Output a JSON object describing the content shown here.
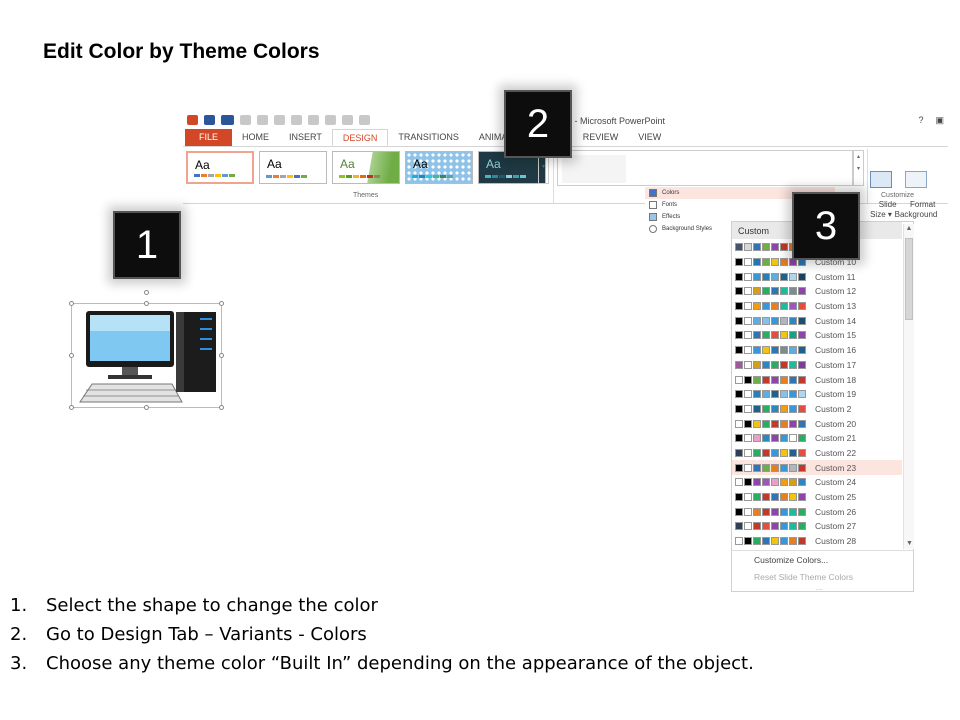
{
  "slide": {
    "title": "Edit Color by Theme Colors"
  },
  "ribbon": {
    "window_title": "e - Microsoft PowerPoint",
    "window_controls": [
      "?",
      "▣"
    ],
    "tabs": [
      {
        "label": "FILE"
      },
      {
        "label": "HOME"
      },
      {
        "label": "INSERT"
      },
      {
        "label": "DESIGN"
      },
      {
        "label": "TRANSITIONS"
      },
      {
        "label": "ANIMATIONS"
      },
      {
        "label": "W"
      },
      {
        "label": "REVIEW"
      },
      {
        "label": "VIEW"
      }
    ],
    "active_tab": "DESIGN",
    "themes_group_label": "Themes",
    "theme_thumb_text": "Aa",
    "slide_size_label": "Slide\nSize ▾",
    "format_background_label": "Format\nBackground",
    "customize_group_label": "Customize",
    "accent_color": "#d24726"
  },
  "variants_menu": {
    "items": [
      {
        "label": "Colors",
        "icon": "colors-icon",
        "highlighted": true
      },
      {
        "label": "Fonts",
        "icon": "fonts-icon"
      },
      {
        "label": "Effects",
        "icon": "effects-icon"
      },
      {
        "label": "Background Styles",
        "icon": "background-styles-icon"
      }
    ]
  },
  "palette": {
    "header": "Custom",
    "rows": [
      {
        "name": "",
        "colors": [
          "#44546a",
          "#d9d9d9",
          "#2e75b6",
          "#70ad47",
          "#8e44ad",
          "#c0392b",
          "#e67e22",
          "#16a085"
        ]
      },
      {
        "name": "Custom 10",
        "colors": [
          "#000000",
          "#ffffff",
          "#1f77b4",
          "#70ad47",
          "#f1c40f",
          "#e67e22",
          "#8e44ad",
          "#2e75b6"
        ]
      },
      {
        "name": "Custom 11",
        "colors": [
          "#000000",
          "#ffffff",
          "#3498db",
          "#2980b9",
          "#5dade2",
          "#1f618d",
          "#aed6f1",
          "#154360"
        ]
      },
      {
        "name": "Custom 12",
        "colors": [
          "#000000",
          "#ffffff",
          "#d4a017",
          "#27ae60",
          "#2e75b6",
          "#1abc9c",
          "#7f8c8d",
          "#8e44ad"
        ]
      },
      {
        "name": "Custom 13",
        "colors": [
          "#000000",
          "#ffffff",
          "#f39c12",
          "#3498db",
          "#e67e22",
          "#1abc9c",
          "#9b59b6",
          "#e74c3c"
        ]
      },
      {
        "name": "Custom 14",
        "colors": [
          "#000000",
          "#ffffff",
          "#5dade2",
          "#85c1e9",
          "#3498db",
          "#aeb6bf",
          "#2e86c1",
          "#1b4f72"
        ]
      },
      {
        "name": "Custom 15",
        "colors": [
          "#000000",
          "#ffffff",
          "#2e75b6",
          "#27ae60",
          "#e74c3c",
          "#f1c40f",
          "#16a085",
          "#8e44ad"
        ]
      },
      {
        "name": "Custom 16",
        "colors": [
          "#000000",
          "#ffffff",
          "#3498db",
          "#f1c40f",
          "#2e75b6",
          "#7f8c8d",
          "#5dade2",
          "#1f618d"
        ]
      },
      {
        "name": "Custom 17",
        "colors": [
          "#a05a9c",
          "#ffffff",
          "#d4a017",
          "#2e86c1",
          "#27ae60",
          "#c0392b",
          "#1abc9c",
          "#7d3c98"
        ]
      },
      {
        "name": "Custom 18",
        "colors": [
          "#ffffff",
          "#000000",
          "#70ad47",
          "#c0392b",
          "#8e44ad",
          "#e67e22",
          "#2e75b6",
          "#c0392b"
        ]
      },
      {
        "name": "Custom 19",
        "colors": [
          "#000000",
          "#ffffff",
          "#2980b9",
          "#5dade2",
          "#1f618d",
          "#85c1e9",
          "#3498db",
          "#aed6f1"
        ]
      },
      {
        "name": "Custom 2",
        "colors": [
          "#000000",
          "#ffffff",
          "#1f618d",
          "#27ae60",
          "#2e86c1",
          "#f39c12",
          "#3498db",
          "#e74c3c"
        ]
      },
      {
        "name": "Custom 20",
        "colors": [
          "#ffffff",
          "#000000",
          "#f1c40f",
          "#27ae60",
          "#c0392b",
          "#e67e22",
          "#8e44ad",
          "#2e75b6"
        ]
      },
      {
        "name": "Custom 21",
        "colors": [
          "#000000",
          "#ffffff",
          "#e8a0c8",
          "#2e86c1",
          "#8e44ad",
          "#3498db",
          "#ffffff",
          "#27ae60"
        ]
      },
      {
        "name": "Custom 22",
        "colors": [
          "#2e4057",
          "#ffffff",
          "#27ae60",
          "#c0392b",
          "#3498db",
          "#f1c40f",
          "#1f618d",
          "#e74c3c"
        ]
      },
      {
        "name": "Custom 23",
        "colors": [
          "#000000",
          "#ffffff",
          "#2e75b6",
          "#70ad47",
          "#e67e22",
          "#3498db",
          "#aeb6bf",
          "#c0392b"
        ]
      },
      {
        "name": "Custom 24",
        "colors": [
          "#ffffff",
          "#000000",
          "#8e44ad",
          "#9b59b6",
          "#e8a0c8",
          "#f39c12",
          "#d4a017",
          "#2e86c1"
        ]
      },
      {
        "name": "Custom 25",
        "colors": [
          "#000000",
          "#ffffff",
          "#27ae60",
          "#c0392b",
          "#2e75b6",
          "#e67e22",
          "#f1c40f",
          "#8e44ad"
        ]
      },
      {
        "name": "Custom 26",
        "colors": [
          "#000000",
          "#ffffff",
          "#e67e22",
          "#c0392b",
          "#8e44ad",
          "#3498db",
          "#1abc9c",
          "#27ae60"
        ]
      },
      {
        "name": "Custom 27",
        "colors": [
          "#2e4057",
          "#ffffff",
          "#c0392b",
          "#e74c3c",
          "#8e44ad",
          "#3498db",
          "#1abc9c",
          "#27ae60"
        ]
      },
      {
        "name": "Custom 28",
        "colors": [
          "#ffffff",
          "#000000",
          "#27ae60",
          "#2e75b6",
          "#f1c40f",
          "#3498db",
          "#e67e22",
          "#c0392b"
        ]
      }
    ],
    "highlighted_row": "Custom 23",
    "footer": {
      "customize": "Customize Colors...",
      "reset": "Reset Slide Theme Colors",
      "grip": "....",
      "reset_disabled": true
    },
    "highlight_color": "#fde5df"
  },
  "badges": {
    "one": "1",
    "two": "2",
    "three": "3"
  },
  "instructions": [
    {
      "num": "1.",
      "text": "Select the shape to change the color"
    },
    {
      "num": "2.",
      "text": "Go to Design Tab – Variants - Colors"
    },
    {
      "num": "3.",
      "text": "Choose any theme color “Built In” depending on the appearance of the object."
    }
  ]
}
